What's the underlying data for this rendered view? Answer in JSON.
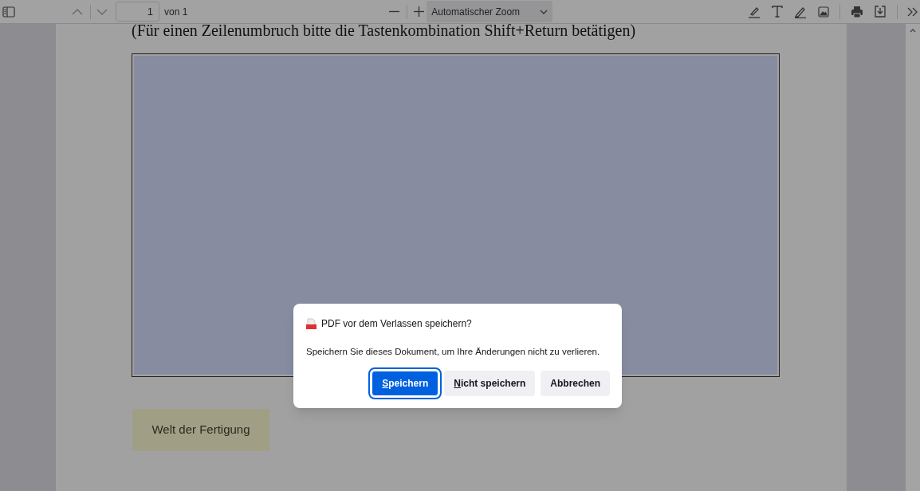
{
  "toolbar": {
    "page_number": "1",
    "page_count": "von 1",
    "zoom": "Automatischer Zoom"
  },
  "document": {
    "instruction": "(Für einen Zeilenumbruch bitte die Tastenkombination Shift+Return betätigen)",
    "form_button": "Welt der Fertigung"
  },
  "dialog": {
    "title": "PDF vor dem Verlassen speichern?",
    "message": "Speichern Sie dieses Dokument, um Ihre Änderungen nicht zu verlieren.",
    "buttons": [
      {
        "label": "Speichern",
        "kind": "primary",
        "underline_first_letter": true
      },
      {
        "label": "Nicht speichern",
        "kind": "secondary",
        "underline_first_letter": true
      },
      {
        "label": "Abbrechen",
        "kind": "secondary",
        "underline_first_letter": false
      }
    ]
  }
}
